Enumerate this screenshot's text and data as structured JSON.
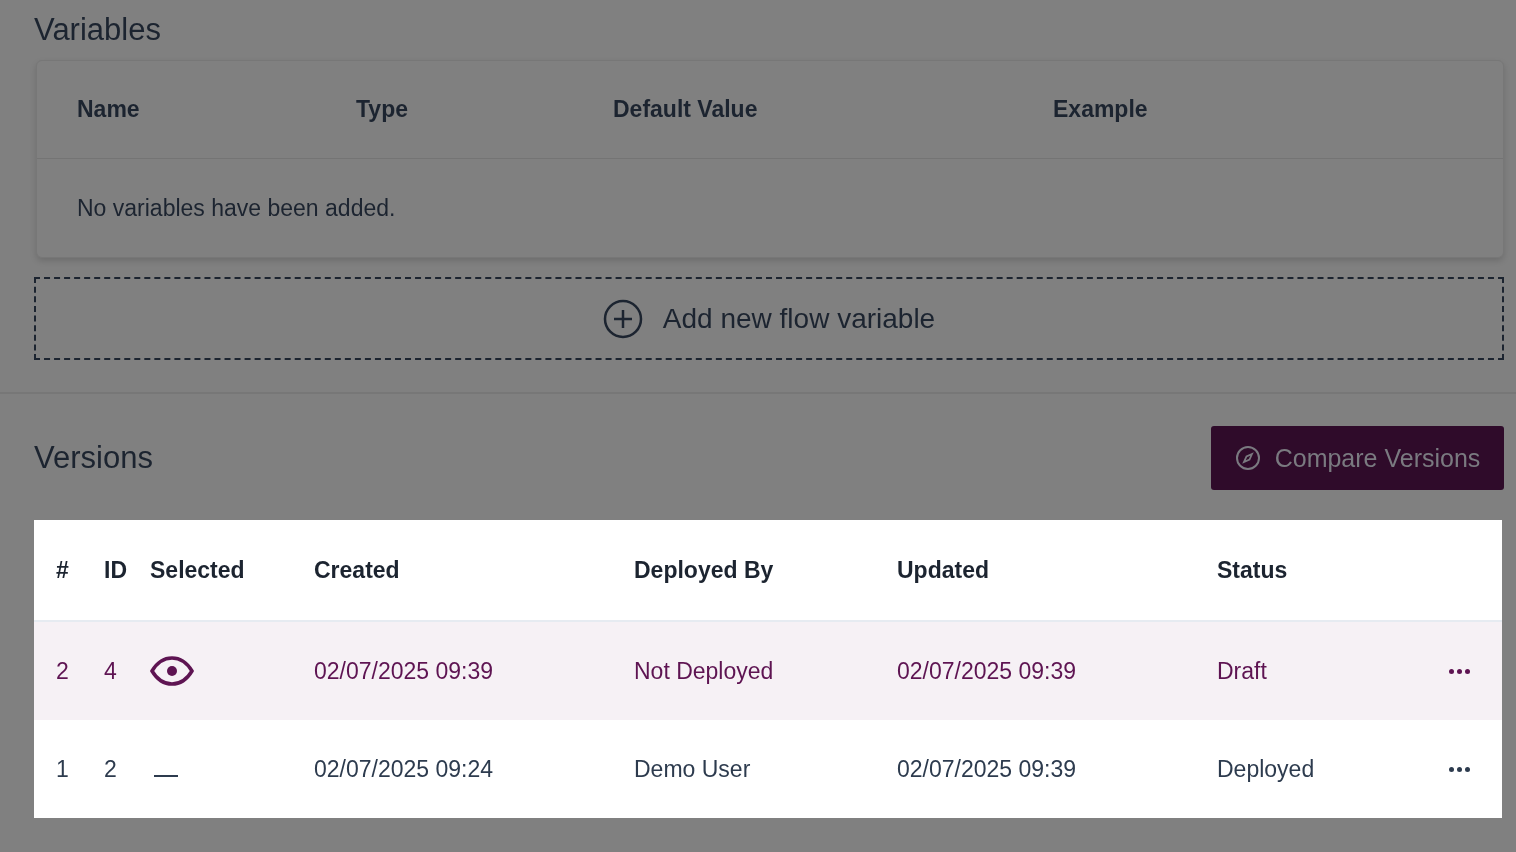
{
  "variables": {
    "title": "Variables",
    "columns": [
      "Name",
      "Type",
      "Default Value",
      "Example"
    ],
    "empty_message": "No variables have been added.",
    "add_button": "Add new flow variable"
  },
  "versions": {
    "title": "Versions",
    "compare_button": "Compare Versions",
    "columns": [
      "#",
      "ID",
      "Selected",
      "Created",
      "Deployed By",
      "Updated",
      "Status"
    ],
    "rows": [
      {
        "number": "2",
        "id": "4",
        "selected": true,
        "created": "02/07/2025 09:39",
        "deployed_by": "Not Deployed",
        "updated": "02/07/2025 09:39",
        "status": "Draft"
      },
      {
        "number": "1",
        "id": "2",
        "selected": false,
        "created": "02/07/2025 09:24",
        "deployed_by": "Demo User",
        "updated": "02/07/2025 09:39",
        "status": "Deployed"
      }
    ]
  }
}
